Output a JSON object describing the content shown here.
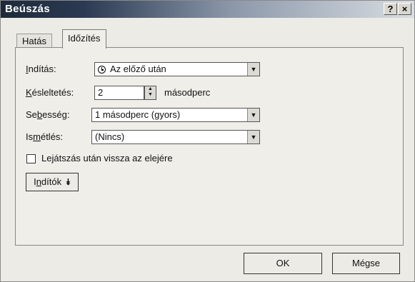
{
  "window": {
    "title": "Beúszás",
    "help": "?",
    "close": "×"
  },
  "tabs": [
    {
      "label": "Hatás"
    },
    {
      "label": "Időzítés",
      "active": true
    }
  ],
  "fields": {
    "start": {
      "label_pre": "",
      "label_u": "I",
      "label_post": "ndítás:",
      "value": "Az előző után",
      "icon": "clock-icon"
    },
    "delay": {
      "label_pre": "",
      "label_u": "K",
      "label_post": "ésleltetés:",
      "value": "2",
      "unit": "másodperc"
    },
    "speed": {
      "label_pre": "Se",
      "label_u": "b",
      "label_post": "esség:",
      "value": "1 másodperc (gyors)"
    },
    "repeat": {
      "label_pre": "Is",
      "label_u": "m",
      "label_post": "étlés:",
      "value": "(Nincs)"
    }
  },
  "rewind": {
    "label_pre": "Le",
    "label_u": "j",
    "label_post": "átszás után vissza az elejére",
    "checked": false
  },
  "triggers": {
    "label_pre": "I",
    "label_u": "n",
    "label_post": "dítók"
  },
  "buttons": {
    "ok": "OK",
    "cancel": "Mégse"
  }
}
